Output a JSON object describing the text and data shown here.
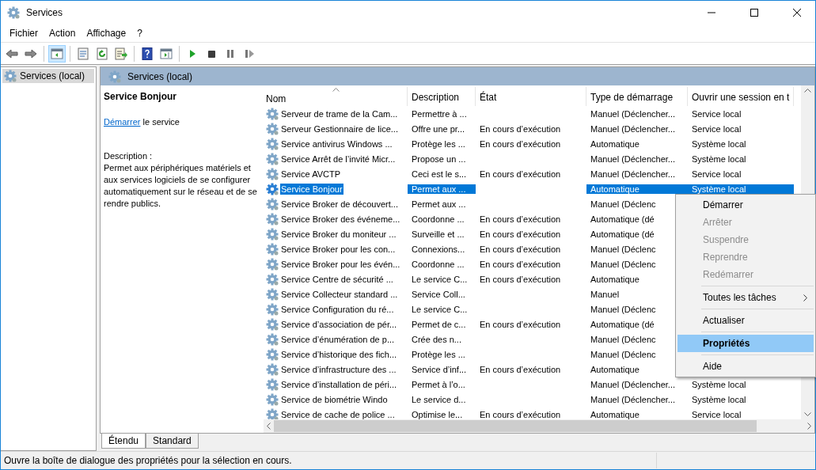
{
  "window": {
    "title": "Services"
  },
  "menu_bar": [
    "Fichier",
    "Action",
    "Affichage",
    "?"
  ],
  "toolbar": [
    {
      "kind": "back",
      "pressed": false
    },
    {
      "kind": "forward",
      "pressed": false
    },
    {
      "kind": "separator"
    },
    {
      "kind": "console-tree",
      "pressed": true
    },
    {
      "kind": "separator"
    },
    {
      "kind": "properties",
      "pressed": false
    },
    {
      "kind": "refresh",
      "pressed": false
    },
    {
      "kind": "export",
      "pressed": false
    },
    {
      "kind": "separator"
    },
    {
      "kind": "help",
      "pressed": false
    },
    {
      "kind": "action-pane",
      "pressed": false
    },
    {
      "kind": "separator"
    },
    {
      "kind": "start",
      "pressed": false
    },
    {
      "kind": "stop",
      "pressed": false
    },
    {
      "kind": "pause",
      "pressed": false
    },
    {
      "kind": "resume",
      "pressed": false
    }
  ],
  "tree": {
    "items": [
      {
        "label": "Services (local)",
        "selected": true
      }
    ]
  },
  "pane": {
    "title": "Services (local)",
    "detail": {
      "service_name": "Service Bonjour",
      "action_link": "Démarrer",
      "action_text": "le service",
      "description_label": "Description :",
      "description": "Permet aux périphériques matériels et aux services logiciels de se configurer automatiquement sur le réseau et de se rendre publics."
    },
    "table": {
      "columns": [
        {
          "label": "Nom",
          "sorted": true
        },
        {
          "label": "Description",
          "sorted": false
        },
        {
          "label": "État",
          "sorted": false
        },
        {
          "label": "Type de démarrage",
          "sorted": false
        },
        {
          "label": "Ouvrir une session en t",
          "sorted": false
        }
      ],
      "rows": [
        {
          "name": "Serveur de trame de la Cam...",
          "description": "Permettre à ...",
          "state": "",
          "startup": "Manuel (Déclencher...",
          "logon": "Service local",
          "selected": false
        },
        {
          "name": "Serveur Gestionnaire de lice...",
          "description": "Offre une pr...",
          "state": "En cours d’exécution",
          "startup": "Manuel (Déclencher...",
          "logon": "Service local",
          "selected": false
        },
        {
          "name": "Service antivirus Windows ...",
          "description": "Protège les ...",
          "state": "En cours d’exécution",
          "startup": "Automatique",
          "logon": "Système local",
          "selected": false
        },
        {
          "name": "Service Arrêt de l’invité Micr...",
          "description": "Propose un ...",
          "state": "",
          "startup": "Manuel (Déclencher...",
          "logon": "Système local",
          "selected": false
        },
        {
          "name": "Service AVCTP",
          "description": "Ceci est le s...",
          "state": "En cours d’exécution",
          "startup": "Manuel (Déclencher...",
          "logon": "Service local",
          "selected": false
        },
        {
          "name": "Service Bonjour",
          "description": "Permet aux ...",
          "state": "",
          "startup": "Automatique",
          "logon": "Système local",
          "selected": true
        },
        {
          "name": "Service Broker de découvert...",
          "description": "Permet aux ...",
          "state": "",
          "startup": "Manuel (Déclenc",
          "logon": "",
          "selected": false
        },
        {
          "name": "Service Broker des événeme...",
          "description": "Coordonne ...",
          "state": "En cours d’exécution",
          "startup": "Automatique (dé",
          "logon": "",
          "selected": false
        },
        {
          "name": "Service Broker du moniteur ...",
          "description": "Surveille et ...",
          "state": "En cours d’exécution",
          "startup": "Automatique (dé",
          "logon": "",
          "selected": false
        },
        {
          "name": "Service Broker pour les con...",
          "description": "Connexions...",
          "state": "En cours d’exécution",
          "startup": "Manuel (Déclenc",
          "logon": "",
          "selected": false
        },
        {
          "name": "Service Broker pour les évén...",
          "description": "Coordonne ...",
          "state": "En cours d’exécution",
          "startup": "Manuel (Déclenc",
          "logon": "",
          "selected": false
        },
        {
          "name": "Service Centre de sécurité ...",
          "description": "Le service C...",
          "state": "En cours d’exécution",
          "startup": "Automatique",
          "logon": "",
          "selected": false
        },
        {
          "name": "Service Collecteur standard ...",
          "description": "Service Coll...",
          "state": "",
          "startup": "Manuel",
          "logon": "",
          "selected": false
        },
        {
          "name": "Service Configuration du ré...",
          "description": "Le service C...",
          "state": "",
          "startup": "Manuel (Déclenc",
          "logon": "",
          "selected": false
        },
        {
          "name": "Service d’association de pér...",
          "description": "Permet de c...",
          "state": "En cours d’exécution",
          "startup": "Automatique (dé",
          "logon": "",
          "selected": false
        },
        {
          "name": "Service d’énumération de p...",
          "description": "Crée des n...",
          "state": "",
          "startup": "Manuel (Déclenc",
          "logon": "",
          "selected": false
        },
        {
          "name": "Service d’historique des fich...",
          "description": "Protège les ...",
          "state": "",
          "startup": "Manuel (Déclenc",
          "logon": "",
          "selected": false
        },
        {
          "name": "Service d’infrastructure des ...",
          "description": "Service d’inf...",
          "state": "En cours d’exécution",
          "startup": "Automatique",
          "logon": "",
          "selected": false
        },
        {
          "name": "Service d’installation de péri...",
          "description": "Permet à l’o...",
          "state": "",
          "startup": "Manuel (Déclencher...",
          "logon": "Système local",
          "selected": false
        },
        {
          "name": "Service de biométrie Windo",
          "description": "Le service d...",
          "state": "",
          "startup": "Manuel (Déclencher...",
          "logon": "Système local",
          "selected": false
        },
        {
          "name": "Service de cache de police ...",
          "description": "Optimise le...",
          "state": "En cours d’exécution",
          "startup": "Automatique",
          "logon": "Service local",
          "selected": false
        }
      ]
    },
    "view_tabs": [
      {
        "label": "Étendu",
        "selected": true
      },
      {
        "label": "Standard",
        "selected": false
      }
    ]
  },
  "context_menu": [
    {
      "kind": "item",
      "label": "Démarrer",
      "disabled": false,
      "default": false,
      "selected": false
    },
    {
      "kind": "item",
      "label": "Arrêter",
      "disabled": true,
      "default": false,
      "selected": false
    },
    {
      "kind": "item",
      "label": "Suspendre",
      "disabled": true,
      "default": false,
      "selected": false
    },
    {
      "kind": "item",
      "label": "Reprendre",
      "disabled": true,
      "default": false,
      "selected": false
    },
    {
      "kind": "item",
      "label": "Redémarrer",
      "disabled": true,
      "default": false,
      "selected": false
    },
    {
      "kind": "separator"
    },
    {
      "kind": "submenu",
      "label": "Toutes les tâches",
      "disabled": false,
      "default": false,
      "selected": false
    },
    {
      "kind": "separator"
    },
    {
      "kind": "item",
      "label": "Actualiser",
      "disabled": false,
      "default": false,
      "selected": false
    },
    {
      "kind": "separator"
    },
    {
      "kind": "item",
      "label": "Propriétés",
      "disabled": false,
      "default": true,
      "selected": true
    },
    {
      "kind": "separator"
    },
    {
      "kind": "item",
      "label": "Aide",
      "disabled": false,
      "default": false,
      "selected": false
    }
  ],
  "status_bar": "Ouvre la boîte de dialogue des propriétés pour la sélection en cours."
}
